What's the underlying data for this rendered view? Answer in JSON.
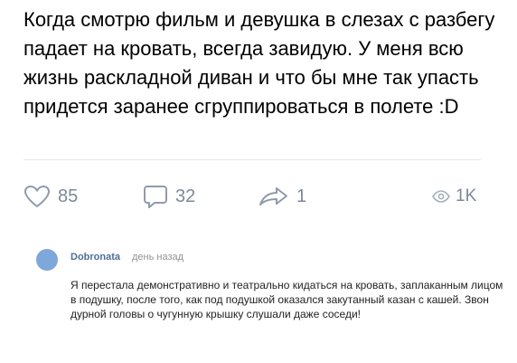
{
  "post": {
    "text": "Когда смотрю фильм и девушка в слезах с разбегу падает на кровать, всегда завидую. У меня всю жизнь раскладной диван и что бы мне так упасть придется заранее сгруппироваться в полете :D"
  },
  "actions": {
    "likes": "85",
    "comments": "32",
    "shares": "1",
    "views": "1K",
    "icons": {
      "like": "heart-icon",
      "comment": "speech-bubble-icon",
      "share": "share-arrow-icon",
      "views": "eye-icon"
    }
  },
  "comment": {
    "author": "Dobronata",
    "time": "день назад",
    "text": "Я перестала демонстративно и театрально кидаться на кровать, заплаканным лицом в подушку, после того, как под подушкой оказался закутанный казан с кашей. Звон дурной головы о чугунную крышку слушали даже соседи!"
  },
  "colors": {
    "icon_gray": "#7c8a99",
    "author_blue": "#4a6f9a",
    "avatar_blue": "#7ea7db"
  }
}
